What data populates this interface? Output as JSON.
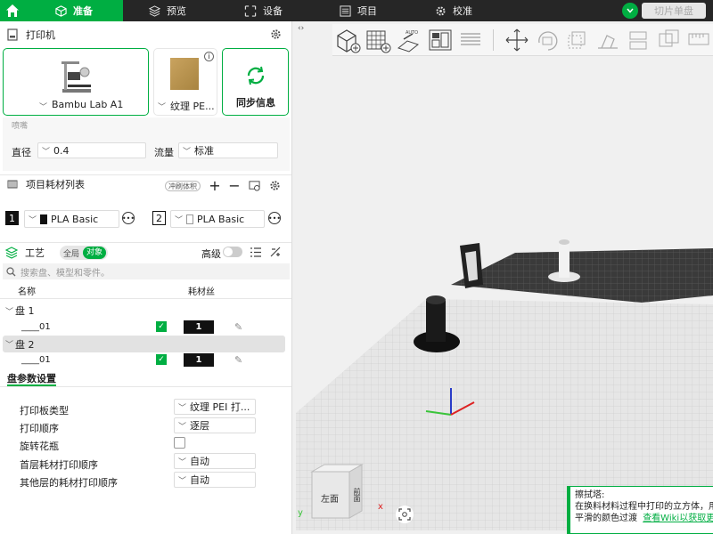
{
  "tabs": [
    {
      "label": "准备"
    },
    {
      "label": "预览"
    },
    {
      "label": "设备"
    },
    {
      "label": "项目"
    },
    {
      "label": "校准"
    }
  ],
  "slice_button": "切片单盘",
  "printer": {
    "section_title": "打印机",
    "name": "Bambu Lab A1",
    "plate": "纹理 PE...",
    "sync": "同步信息",
    "nozzle_label": "喷嘴",
    "diameter_label": "直径",
    "diameter": "0.4",
    "flow_label": "流量",
    "flow": "标准"
  },
  "filaments": {
    "section_title": "项目耗材列表",
    "flush_label": "冲刷体积",
    "items": [
      {
        "num": "1",
        "name": "PLA Basic",
        "color": "#111111"
      },
      {
        "num": "2",
        "name": "PLA Basic",
        "color": "#ffffff"
      }
    ]
  },
  "process": {
    "section_title": "工艺",
    "toggle_global": "全局",
    "toggle_object": "对象",
    "advanced": "高级",
    "search_placeholder": "搜索盘、模型和零件。",
    "col_name": "名称",
    "col_filament": "耗材丝",
    "tree": [
      {
        "group": "盘 1",
        "item": "____01",
        "filament": "1"
      },
      {
        "group": "盘 2",
        "item": "____01",
        "filament": "1"
      }
    ]
  },
  "plate_settings": {
    "tab": "盘参数设置",
    "rows": [
      {
        "label": "打印板类型",
        "value": "纹理 PEI 打..."
      },
      {
        "label": "打印顺序",
        "value": "逐层"
      },
      {
        "label": "旋转花瓶",
        "value": ""
      },
      {
        "label": "首层耗材打印顺序",
        "value": "自动"
      },
      {
        "label": "其他层的耗材打印顺序",
        "value": "自动"
      }
    ]
  },
  "viewport": {
    "cube_face_left": "左面",
    "cube_face_front": "前面",
    "axis_y": "y",
    "axis_x": "x",
    "tip_title": "擦拭塔:",
    "tip_line1": "在换料材料过程中打印的立方体，用于",
    "tip_line2": "平滑的颜色过渡",
    "tip_link": "查看Wiki以获取更多"
  },
  "colors": {
    "accent": "#00ae42",
    "topbar": "#262626"
  }
}
